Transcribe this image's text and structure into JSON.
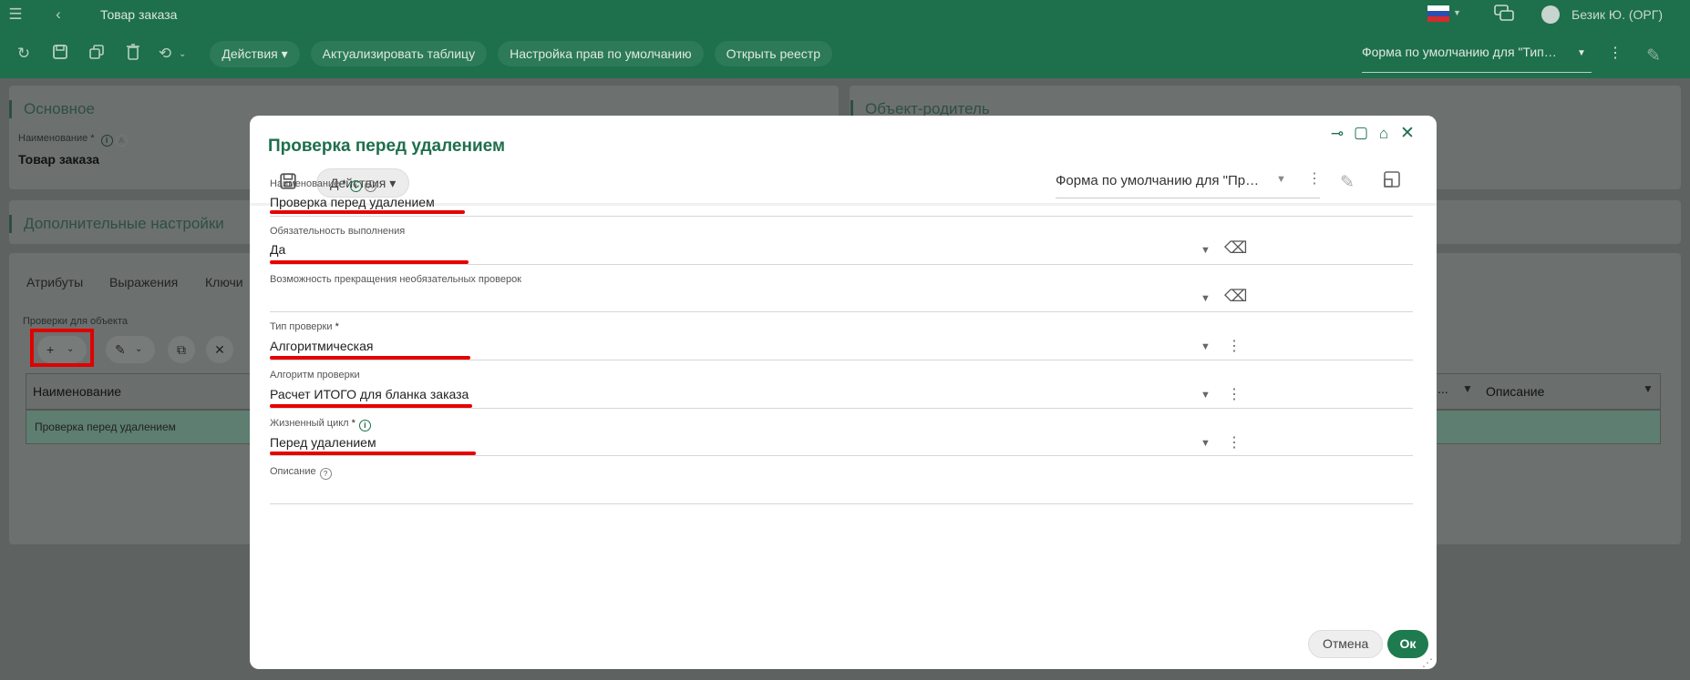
{
  "topbar": {
    "title": "Товар заказа",
    "user": "Безик Ю. (ОРГ)"
  },
  "toolbar": {
    "actions_label": "Действия",
    "refresh_table_label": "Актуализировать таблицу",
    "rights_label": "Настройка прав по умолчанию",
    "open_registry_label": "Открыть реестр",
    "form_select_value": "Форма по умолчанию для \"Тип…"
  },
  "background": {
    "main_section_title": "Основное",
    "name_label": "Наименование *",
    "name_value": "Товар заказа",
    "parent_section_title": "Объект-родитель",
    "extra_section_title": "Дополнительные настройки",
    "tabs": [
      "Атрибуты",
      "Выражения",
      "Ключи"
    ],
    "checks_label": "Проверки для объекта",
    "table_col_name": "Наименование",
    "table_col_desc": "Описание",
    "table_col_partial": "...",
    "table_row_value": "Проверка перед удалением"
  },
  "dialog": {
    "title": "Проверка перед удалением",
    "actions_label": "Действия",
    "form_select_value": "Форма по умолчанию для \"Пр…",
    "fields": {
      "name": {
        "label": "Наименование",
        "value": "Проверка перед удалением"
      },
      "obligation": {
        "label": "Обязательность выполнения",
        "value": "Да"
      },
      "stop_optional": {
        "label": "Возможность прекращения необязательных проверок",
        "value": ""
      },
      "check_type": {
        "label": "Тип проверки",
        "value": "Алгоритмическая"
      },
      "algorithm": {
        "label": "Алгоритм проверки",
        "value": "Расчет ИТОГО для бланка заказа"
      },
      "lifecycle": {
        "label": "Жизненный цикл",
        "value": "Перед удалением"
      },
      "description": {
        "label": "Описание",
        "value": ""
      }
    },
    "required_mark": "*",
    "cancel_label": "Отмена",
    "ok_label": "Ок"
  },
  "colors": {
    "brand": "#1e6f4c",
    "annotation": "#e60000"
  }
}
